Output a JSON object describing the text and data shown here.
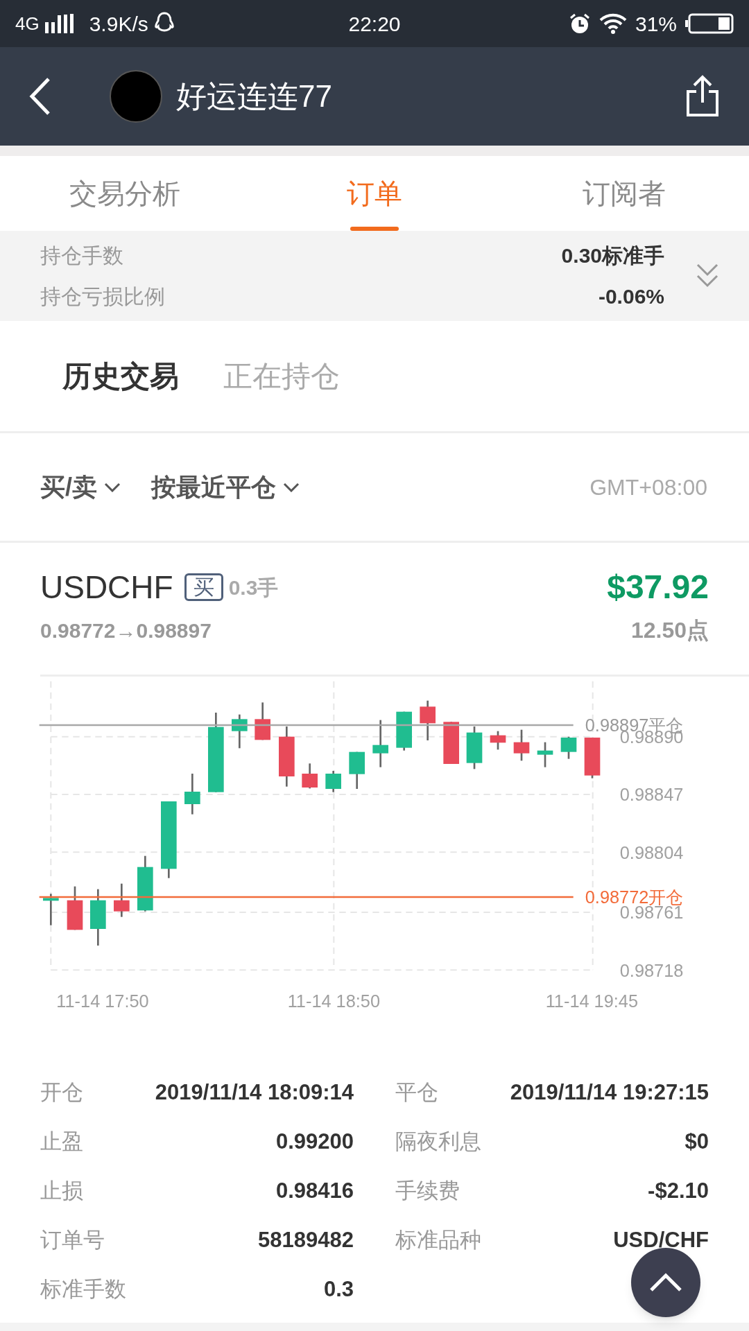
{
  "status_bar": {
    "network": "4G",
    "speed": "3.9K/s",
    "time": "22:20",
    "battery": "31%"
  },
  "header": {
    "title": "好运连连77"
  },
  "tabs": [
    {
      "label": "交易分析",
      "selected": false
    },
    {
      "label": "订单",
      "selected": true
    },
    {
      "label": "订阅者",
      "selected": false
    }
  ],
  "summary": [
    {
      "label": "持仓手数",
      "value": "0.30标准手"
    },
    {
      "label": "持仓亏损比例",
      "value": "-0.06%"
    }
  ],
  "sub_tabs": [
    {
      "label": "历史交易",
      "selected": true
    },
    {
      "label": "正在持仓",
      "selected": false
    }
  ],
  "filters": [
    {
      "label": "买/卖"
    },
    {
      "label": "按最近平仓"
    }
  ],
  "timezone": "GMT+08:00",
  "trade": {
    "symbol": "USDCHF",
    "side": "买",
    "lots": "0.3手",
    "profit": "$37.92",
    "prices": "0.98772→0.98897",
    "points": "12.50点",
    "chart": {
      "y_labels": [
        "0.98890",
        "0.98847",
        "0.98804",
        "0.98761",
        "0.98718"
      ],
      "x_labels": [
        "11-14 17:50",
        "11-14 18:50",
        "11-14 19:45"
      ],
      "close_line": "0.98897平仓",
      "open_line": "0.98772开仓"
    },
    "details": [
      {
        "label": "开仓",
        "value": "2019/11/14 18:09:14"
      },
      {
        "label": "平仓",
        "value": "2019/11/14 19:27:15"
      },
      {
        "label": "止盈",
        "value": "0.99200"
      },
      {
        "label": "隔夜利息",
        "value": "$0"
      },
      {
        "label": "止损",
        "value": "0.98416"
      },
      {
        "label": "手续费",
        "value": "-$2.10"
      },
      {
        "label": "订单号",
        "value": "58189482"
      },
      {
        "label": "标准品种",
        "value": "USD/CHF"
      },
      {
        "label": "标准手数",
        "value": "0.3"
      }
    ]
  }
}
